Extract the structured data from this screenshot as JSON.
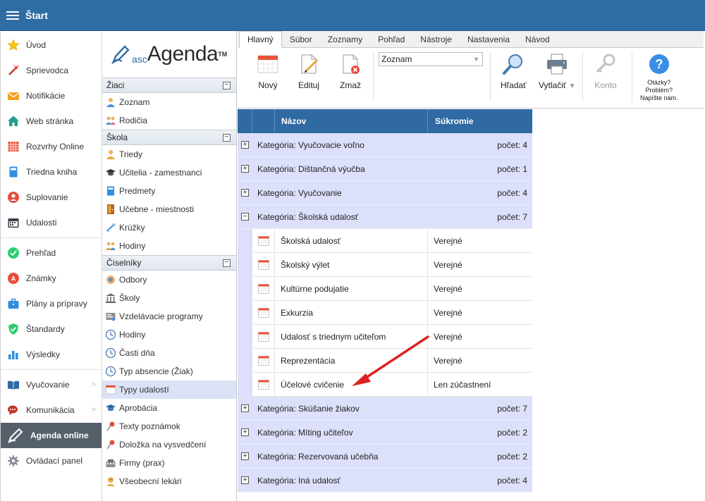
{
  "header": {
    "title": "Štart"
  },
  "leftnav": [
    {
      "label": "Úvod",
      "icon": "star-icon"
    },
    {
      "label": "Sprievodca",
      "icon": "wand-icon"
    },
    {
      "label": "Notifikácie",
      "icon": "envelope-icon"
    },
    {
      "label": "Web stránka",
      "icon": "house-icon"
    },
    {
      "label": "Rozvrhy Online",
      "icon": "grid-calendar-icon"
    },
    {
      "label": "Triedna kniha",
      "icon": "book-icon"
    },
    {
      "label": "Suplovanie",
      "icon": "person-badge-icon"
    },
    {
      "label": "Udalosti",
      "icon": "calendar-icon"
    },
    {
      "label": "Prehľad",
      "icon": "check-circle-icon"
    },
    {
      "label": "Známky",
      "icon": "grade-pin-icon"
    },
    {
      "label": "Plány a prípravy",
      "icon": "briefcase-icon"
    },
    {
      "label": "Štandardy",
      "icon": "shield-check-icon"
    },
    {
      "label": "Výsledky",
      "icon": "bar-chart-icon"
    },
    {
      "label": "Vyučovanie",
      "icon": "open-book-icon"
    },
    {
      "label": "Komunikácia",
      "icon": "chat-icon"
    },
    {
      "label": "Agenda online",
      "icon": "pen-icon"
    },
    {
      "label": "Ovládací panel",
      "icon": "gear-icon"
    }
  ],
  "logo": {
    "prefix": "asc",
    "name": "Agenda",
    "tm": "TM"
  },
  "sections": {
    "ziaci": {
      "title": "Žiaci",
      "items": [
        "Zoznam",
        "Rodičia"
      ]
    },
    "skola": {
      "title": "Škola",
      "items": [
        "Triedy",
        "Učitelia - zamestnanci",
        "Predmety",
        "Učebne - miestnosti",
        "Krúžky",
        "Hodiny"
      ]
    },
    "ciselniky": {
      "title": "Číselníky",
      "items": [
        "Odbory",
        "Školy",
        "Vzdelávacie programy",
        "Hodiny",
        "Časti dňa",
        "Typ absencie (Žiak)",
        "Typy udalostí",
        "Aprobácia",
        "Texty poznámok",
        "Doložka na vysvedčení",
        "Firmy (prax)",
        "Všeobecní lekári"
      ]
    }
  },
  "ribbon": {
    "tabs": [
      "Hlavný",
      "Súbor",
      "Zoznamy",
      "Pohľad",
      "Nástroje",
      "Nastavenia",
      "Návod"
    ],
    "buttons": {
      "new": "Nový",
      "edit": "Edituj",
      "delete": "Zmaž",
      "search": "Hľadať",
      "print": "Vytlačiť",
      "account": "Konto"
    },
    "view_select": "Zoznam",
    "help": {
      "line1": "Otázky?",
      "line2": "Problém?",
      "line3": "Napíšte nám."
    }
  },
  "grid": {
    "headers": {
      "name": "Názov",
      "privacy": "Súkromie"
    },
    "categories": [
      {
        "label": "Kategória: Vyučovacie voľno",
        "count": "počet: 4",
        "expanded": false
      },
      {
        "label": "Kategória: Dištančná výučba",
        "count": "počet: 1",
        "expanded": false
      },
      {
        "label": "Kategória: Vyučovanie",
        "count": "počet: 4",
        "expanded": false
      },
      {
        "label": "Kategória: Školská udalosť",
        "count": "počet: 7",
        "expanded": true
      },
      {
        "label": "Kategória: Skúšanie žiakov",
        "count": "počet: 7",
        "expanded": false
      },
      {
        "label": "Kategória: Míting učiteľov",
        "count": "počet: 2",
        "expanded": false
      },
      {
        "label": "Kategória: Rezervovaná učebňa",
        "count": "počet: 2",
        "expanded": false
      },
      {
        "label": "Kategória: Iná udalosť",
        "count": "počet: 4",
        "expanded": false
      }
    ],
    "rows": [
      {
        "name": "Školská udalosť",
        "privacy": "Verejné"
      },
      {
        "name": "Školský výlet",
        "privacy": "Verejné"
      },
      {
        "name": "Kultúrne podujatie",
        "privacy": "Verejné"
      },
      {
        "name": "Exkurzia",
        "privacy": "Verejné"
      },
      {
        "name": "Udalosť s triednym učiteľom",
        "privacy": "Verejné"
      },
      {
        "name": "Reprezentácia",
        "privacy": "Verejné"
      },
      {
        "name": "Účelové cvičenie",
        "privacy": "Len zúčastnení"
      }
    ]
  },
  "colors": {
    "header": "#2e6da4",
    "grid_header": "#2f6aa2",
    "category_bg": "#dde0fa",
    "active_nav": "#56606b",
    "arrow": "#e02020"
  }
}
